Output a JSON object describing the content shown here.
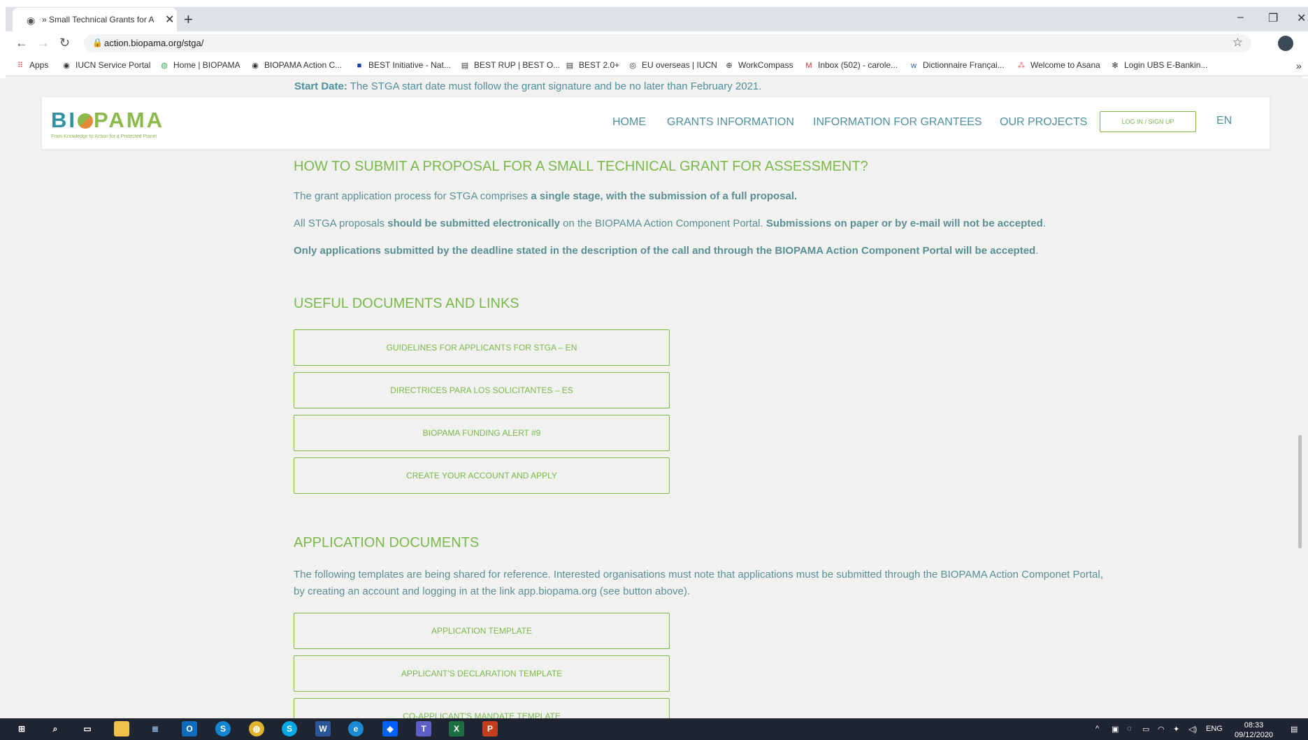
{
  "browser": {
    "tab_title": "» Small Technical Grants for Asse",
    "url": "action.biopama.org/stga/",
    "bookmarks": [
      {
        "label": "Apps",
        "icon": "apps-grid-icon"
      },
      {
        "label": "IUCN Service Portal",
        "icon": "globe-icon"
      },
      {
        "label": "Home | BIOPAMA",
        "icon": "chrome-icon"
      },
      {
        "label": "BIOPAMA Action C...",
        "icon": "globe-icon"
      },
      {
        "label": "BEST Initiative - Nat...",
        "icon": "eu-flag-icon"
      },
      {
        "label": "BEST RUP | BEST O...",
        "icon": "best-icon"
      },
      {
        "label": "BEST 2.0+",
        "icon": "best-icon"
      },
      {
        "label": "EU overseas | IUCN",
        "icon": "iucn-icon"
      },
      {
        "label": "WorkCompass",
        "icon": "workcompass-icon"
      },
      {
        "label": "Inbox (502) - carole...",
        "icon": "gmail-icon"
      },
      {
        "label": "Dictionnaire Françai...",
        "icon": "wordreference-icon"
      },
      {
        "label": "Welcome to Asana",
        "icon": "asana-icon"
      },
      {
        "label": "Login UBS E-Bankin...",
        "icon": "ubs-icon"
      }
    ]
  },
  "page": {
    "start_date_label": "Start Date:",
    "start_date_text": " The STGA start date must follow the grant signature and be no later than February 2021.",
    "logo_word": "BIOPAMA",
    "logo_tagline": "From Knowledge to Action for a Protected Planet",
    "nav": {
      "home": "HOME",
      "grants": "GRANTS INFORMATION",
      "grantees": "INFORMATION FOR GRANTEES",
      "projects": "OUR PROJECTS",
      "login": "LOG IN / SIGN UP",
      "lang": "EN"
    },
    "how_to": {
      "heading": "HOW TO SUBMIT A PROPOSAL FOR A SMALL TECHNICAL GRANT FOR ASSESSMENT?",
      "p1_a": "The grant application process for STGA comprises ",
      "p1_b": "a single stage, with the submission of a full proposal.",
      "p2_a": "All STGA proposals ",
      "p2_b": "should be submitted electronically",
      "p2_c": " on the BIOPAMA Action Component Portal. ",
      "p2_d": "Submissions on paper or by e-mail will not be accepted",
      "p2_e": ".",
      "p3_a": "Only applications submitted by the deadline stated in the description of the call and through the BIOPAMA Action Component Portal will be accepted",
      "p3_b": "."
    },
    "useful": {
      "heading": "USEFUL DOCUMENTS AND LINKS",
      "buttons": [
        "GUIDELINES FOR APPLICANTS FOR STGA – EN",
        "DIRECTRICES PARA LOS SOLICITANTES – ES",
        "BIOPAMA FUNDING ALERT #9",
        "CREATE YOUR ACCOUNT AND APPLY"
      ]
    },
    "application": {
      "heading": "APPLICATION DOCUMENTS",
      "text": "The following templates are being shared for reference. Interested organisations must note that applications must be submitted through the BIOPAMA Action Componet Portal, by creating an account and logging in at the link app.biopama.org (see button above).",
      "buttons": [
        "APPLICATION TEMPLATE",
        "APPLICANT'S DECLARATION TEMPLATE",
        "CO-APPLICANT'S MANDATE TEMPLATE"
      ]
    }
  },
  "taskbar": {
    "lang": "ENG",
    "time": "08:33",
    "date": "09/12/2020"
  }
}
